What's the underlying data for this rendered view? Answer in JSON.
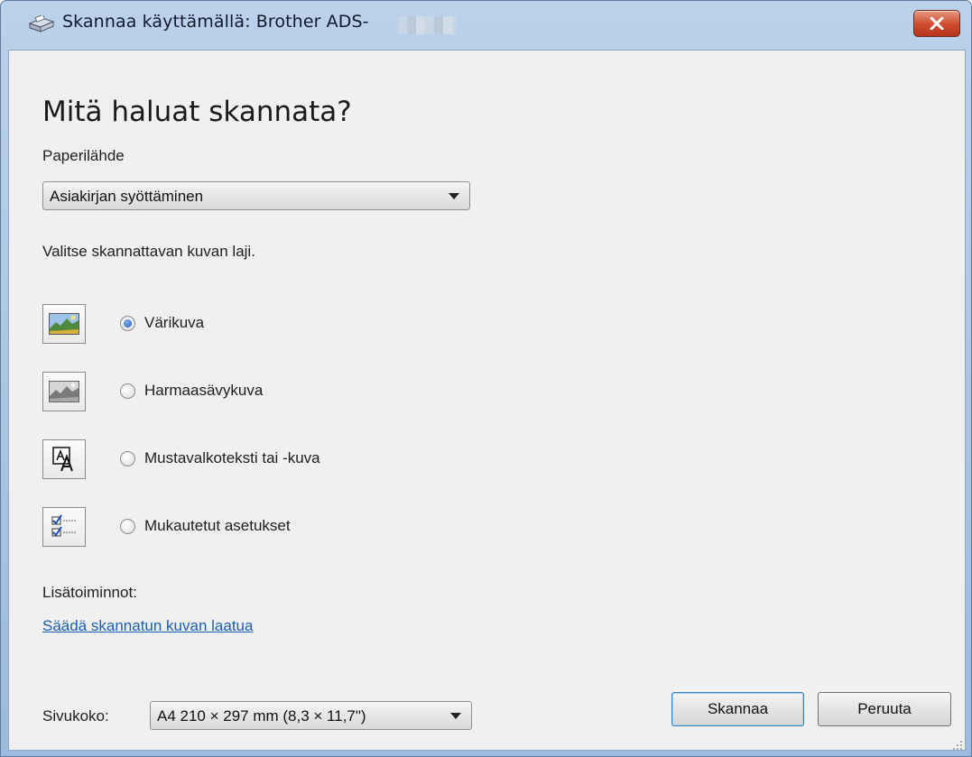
{
  "window": {
    "title": "Skannaa käyttämällä: Brother ADS-"
  },
  "dialog": {
    "heading": "Mitä haluat skannata?",
    "paper_source": {
      "label": "Paperilähde",
      "value": "Asiakirjan syöttäminen"
    },
    "image_type_prompt": "Valitse skannattavan kuvan laji.",
    "options": [
      {
        "label": "Värikuva",
        "icon": "color-picture-icon",
        "checked": true
      },
      {
        "label": "Harmaasävykuva",
        "icon": "grayscale-picture-icon",
        "checked": false
      },
      {
        "label": "Mustavalkoteksti tai -kuva",
        "icon": "black-white-text-icon",
        "checked": false
      },
      {
        "label": "Mukautetut asetukset",
        "icon": "custom-settings-icon",
        "checked": false
      }
    ],
    "more_options_label": "Lisätoiminnot:",
    "adjust_link": "Säädä skannatun kuvan laatua",
    "page_size": {
      "label": "Sivukoko:",
      "value": "A4 210 × 297 mm (8,3 × 11,7\")"
    },
    "buttons": {
      "scan": "Skannaa",
      "cancel": "Peruuta"
    }
  }
}
